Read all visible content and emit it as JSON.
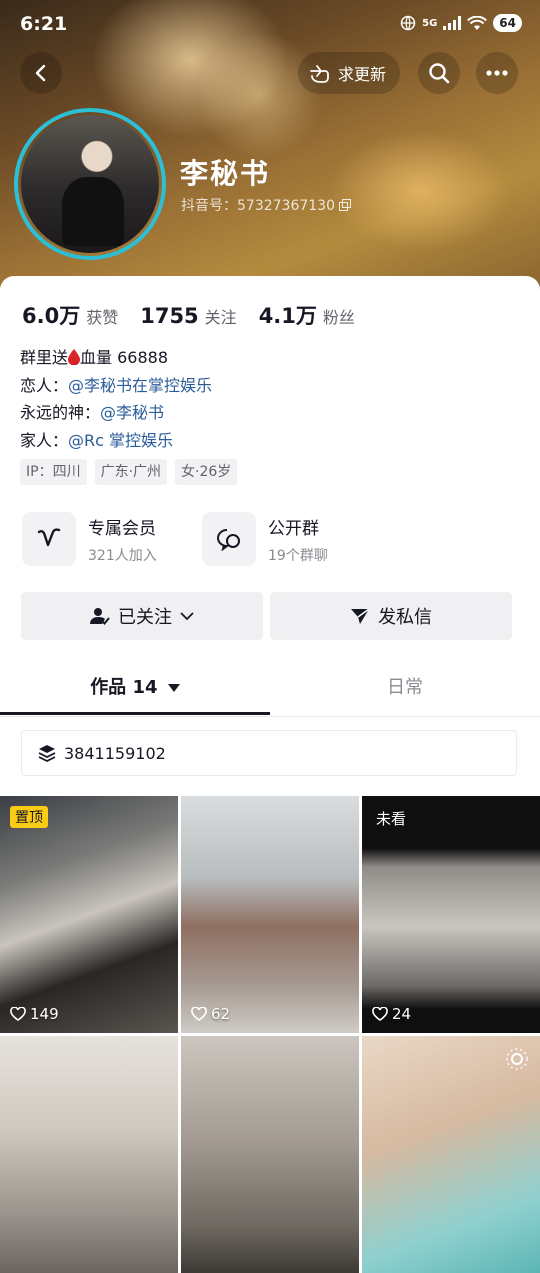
{
  "status_bar": {
    "time": "6:21",
    "network": "5G",
    "battery": "64"
  },
  "header": {
    "update_label": "求更新"
  },
  "profile": {
    "name": "李秘书",
    "douyin_id": "抖音号：57327367130"
  },
  "stats": [
    {
      "value": "6.0万",
      "label": "获赞"
    },
    {
      "value": "1755",
      "label": "关注"
    },
    {
      "value": "4.1万",
      "label": "粉丝"
    }
  ],
  "bio": {
    "line1_prefix": "群里送",
    "line1_suffix": "血量  66888",
    "line2_prefix": "恋人：",
    "line2_link": "@李秘书在掌控娱乐",
    "line3_prefix": "永远的神：",
    "line3_link": "@李秘书",
    "line4_prefix": "家人：",
    "line4_link": "@Rc 掌控娱乐"
  },
  "tags": [
    "IP：四川",
    "广东·广州",
    "女·26岁"
  ],
  "features": [
    {
      "title": "专属会员",
      "subtitle": "321人加入",
      "icon": "v-icon"
    },
    {
      "title": "公开群",
      "subtitle": "19个群聊",
      "icon": "group-chat-icon"
    }
  ],
  "actions": {
    "following": "已关注",
    "message": "发私信"
  },
  "tabs": {
    "works": "作品 14",
    "daily": "日常"
  },
  "collection": {
    "label": "3841159102"
  },
  "grid": [
    {
      "likes": "149",
      "badge": "置顶"
    },
    {
      "likes": "62"
    },
    {
      "likes": "24",
      "badge": "未看"
    },
    {},
    {},
    {}
  ],
  "colors": {
    "accent_ring": "#2dbfd6",
    "link": "#2b5d9a",
    "pin_badge": "#facc15"
  }
}
